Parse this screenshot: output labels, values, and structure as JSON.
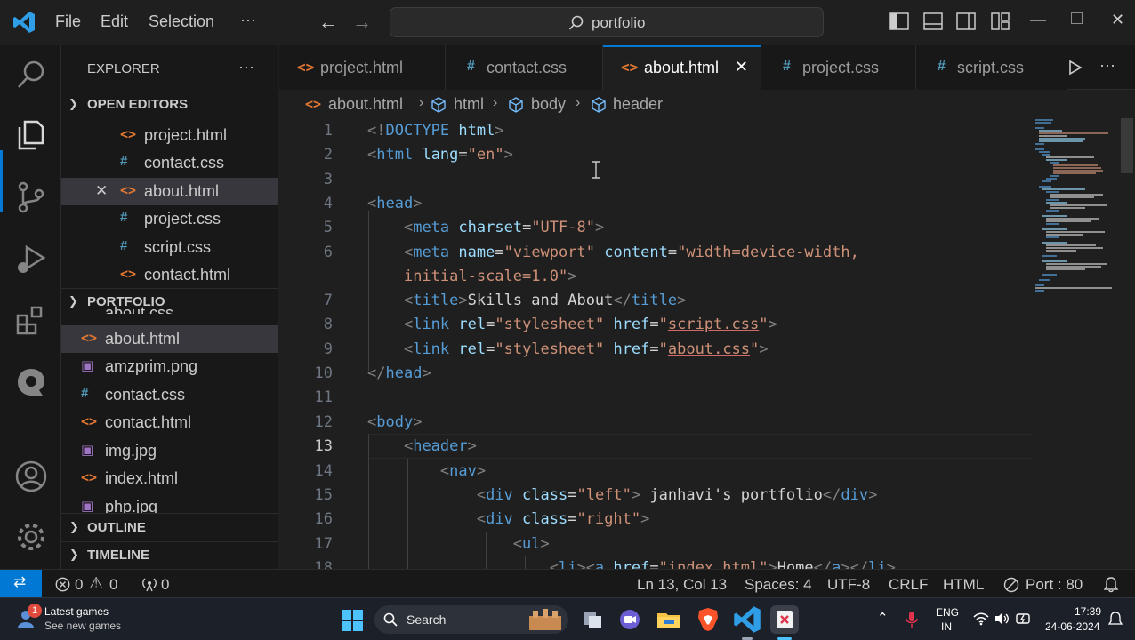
{
  "menu": {
    "file": "File",
    "edit": "Edit",
    "selection": "Selection",
    "more": "···"
  },
  "search": {
    "text": "portfolio"
  },
  "explorer": {
    "title": "EXPLORER",
    "more": "···",
    "open_editors": {
      "title": "OPEN EDITORS",
      "items": [
        {
          "icon": "<>",
          "name": "project.html",
          "type": "html"
        },
        {
          "icon": "#",
          "name": "contact.css",
          "type": "css"
        },
        {
          "icon": "<>",
          "name": "about.html",
          "type": "html",
          "close": "✕"
        },
        {
          "icon": "#",
          "name": "project.css",
          "type": "css"
        },
        {
          "icon": "#",
          "name": "script.css",
          "type": "css"
        },
        {
          "icon": "<>",
          "name": "contact.html",
          "type": "html"
        }
      ]
    },
    "portfolio": {
      "title": "PORTFOLIO",
      "partial_top": "about.css",
      "items": [
        {
          "icon": "<>",
          "name": "about.html",
          "type": "html"
        },
        {
          "icon": "▣",
          "name": "amzprim.png",
          "type": "img"
        },
        {
          "icon": "#",
          "name": "contact.css",
          "type": "css"
        },
        {
          "icon": "<>",
          "name": "contact.html",
          "type": "html"
        },
        {
          "icon": "▣",
          "name": "img.jpg",
          "type": "img"
        },
        {
          "icon": "<>",
          "name": "index.html",
          "type": "html"
        },
        {
          "icon": "▣",
          "name": "php.jpg",
          "type": "img"
        }
      ]
    },
    "outline": "OUTLINE",
    "timeline": "TIMELINE"
  },
  "tabs": [
    {
      "icon": "<>",
      "label": "project.html",
      "type": "html"
    },
    {
      "icon": "#",
      "label": "contact.css",
      "type": "css"
    },
    {
      "icon": "<>",
      "label": "about.html",
      "type": "html",
      "active": true,
      "close": "✕"
    },
    {
      "icon": "#",
      "label": "project.css",
      "type": "css"
    },
    {
      "icon": "#",
      "label": "script.css",
      "type": "css"
    }
  ],
  "breadcrumb": {
    "file": "about.html",
    "b1": "html",
    "b2": "body",
    "b3": "header"
  },
  "code": {
    "line_numbers": [
      "1",
      "2",
      "3",
      "4",
      "5",
      "6",
      "",
      "7",
      "8",
      "9",
      "10",
      "11",
      "12",
      "13",
      "14",
      "15",
      "16",
      "17",
      "18"
    ]
  },
  "status": {
    "errors": "0",
    "warnings": "0",
    "ports_count": "0",
    "position": "Ln 13, Col 13",
    "spaces": "Spaces: 4",
    "encoding": "UTF-8",
    "eol": "CRLF",
    "language": "HTML",
    "port": "Port : 80"
  },
  "taskbar": {
    "news_title": "Latest games",
    "news_sub": "See new games",
    "badge": "1",
    "search_label": "Search",
    "lang": "ENG",
    "region": "IN",
    "time": "17:39",
    "date": "24-06-2024"
  },
  "colors": {
    "accent": "#0078d4",
    "html_icon": "#e37933",
    "css_icon": "#519aba"
  }
}
